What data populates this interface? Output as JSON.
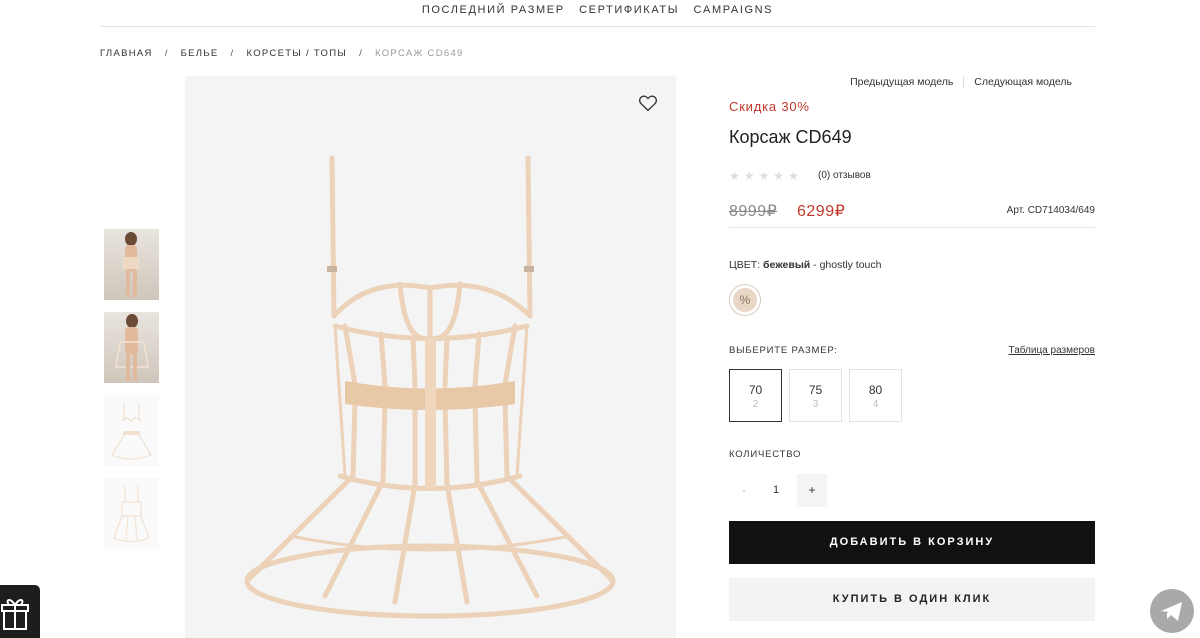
{
  "topnav": {
    "items": [
      "ПОСЛЕДНИЙ РАЗМЕР",
      "СЕРТИФИКАТЫ",
      "CAMPAIGNS"
    ]
  },
  "breadcrumbs": {
    "items": [
      "ГЛАВНАЯ",
      "БЕЛЬЕ",
      "КОРСЕТЫ / ТОПЫ"
    ],
    "current": "КОРСАЖ CD649",
    "separator": "/"
  },
  "gallery": {
    "thumbnails": [
      "model-front",
      "model-back",
      "product-front",
      "product-back"
    ],
    "favorite_icon": "heart-icon"
  },
  "product_nav": {
    "prev": "Предыдущая модель",
    "next": "Следующая модель"
  },
  "product": {
    "discount": "Скидка 30%",
    "title": "Корсаж CD649",
    "rating": {
      "value": 0,
      "max": 5
    },
    "reviews": "(0) отзывов",
    "old_price": "8999₽",
    "new_price": "6299₽",
    "sku": "Арт. CD714034/649"
  },
  "color": {
    "label": "ЦВЕТ:",
    "name": "бежевый",
    "suffix": "- ghostly touch",
    "swatch_color": "#e8d7c5",
    "swatch_symbol": "%"
  },
  "sizes": {
    "label": "ВЫБЕРИТЕ РАЗМЕР:",
    "table_link": "Таблица размеров",
    "options": [
      {
        "size": "70",
        "qty": "2"
      },
      {
        "size": "75",
        "qty": "3"
      },
      {
        "size": "80",
        "qty": "4"
      }
    ],
    "selected": "70"
  },
  "quantity": {
    "label": "КОЛИЧЕСТВО",
    "minus": "-",
    "value": "1",
    "plus": "+"
  },
  "buttons": {
    "add_to_cart": "ДОБАВИТЬ В КОРЗИНУ",
    "one_click": "КУПИТЬ В ОДИН КЛИК"
  },
  "widgets": {
    "gift_icon": "gift-icon",
    "telegram_icon": "telegram-icon"
  },
  "colors": {
    "accent": "#c0392b",
    "product_beige": "#e6c9ad",
    "button_dark": "#111111"
  }
}
